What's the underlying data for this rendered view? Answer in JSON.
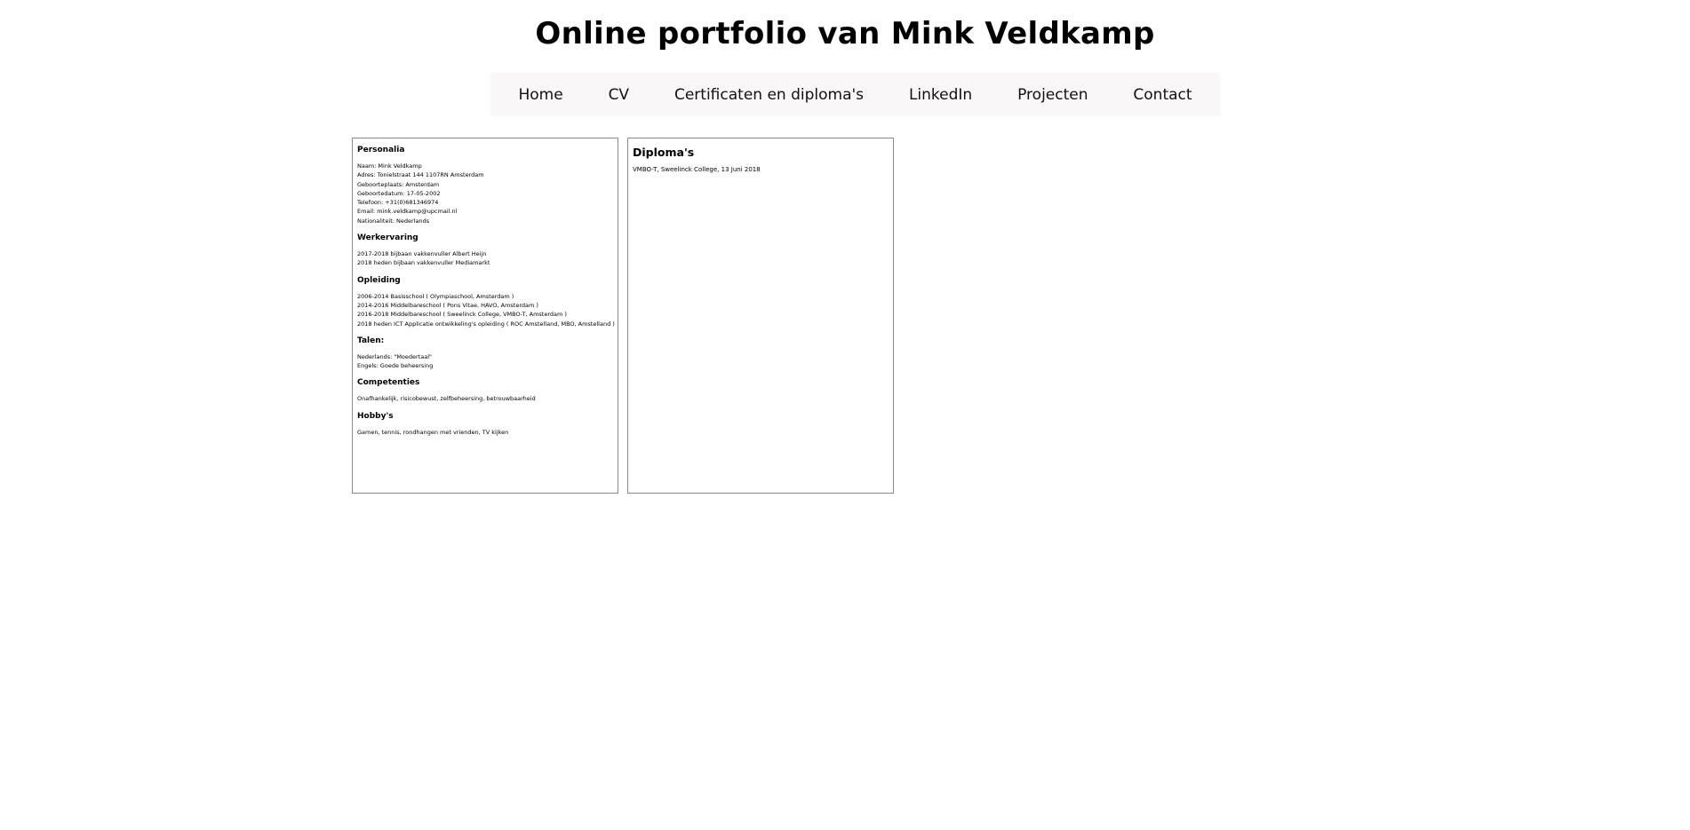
{
  "header": {
    "title": "Online portfolio van Mink Veldkamp"
  },
  "nav": {
    "items": [
      {
        "label": "Home"
      },
      {
        "label": "CV"
      },
      {
        "label": "Certificaten en diploma's"
      },
      {
        "label": "LinkedIn"
      },
      {
        "label": "Projecten"
      },
      {
        "label": "Contact"
      }
    ]
  },
  "cv": {
    "sections": [
      {
        "heading": "Personalia",
        "lines": [
          "Naam: Mink Veldkamp",
          "Adres: Tonielstraat 144 1107RN Amsterdam",
          "Geboorteplaats: Amsterdam",
          "Geboortedatum: 17-05-2002",
          "Telefoon: +31(0)681346974",
          "Email: mink.veldkamp@upcmail.nl",
          "Nationaliteit: Nederlands"
        ]
      },
      {
        "heading": "Werkervaring",
        "lines": [
          "2017-2018 bijbaan vakkenvuller Albert Heijn",
          "2018 heden bijbaan vakkenvuller Mediamarkt"
        ]
      },
      {
        "heading": "Opleiding",
        "lines": [
          "2006-2014 Basisschool ( Olympiaschool, Amsterdam )",
          "2014-2016 Middelbareschool ( Pons Vitae, HAVO, Amsterdam )",
          "2016-2018 Middelbareschool ( Sweelinck College, VMBO-T, Amsterdam )",
          "2018 heden ICT Applicatie ontwikkeling's opleiding ( ROC Amstelland, MBO, Amstelland )"
        ]
      },
      {
        "heading": "Talen:",
        "lines": [
          "Nederlands: \"Moedertaal\"",
          "Engels: Goede beheersing"
        ]
      },
      {
        "heading": "Competenties",
        "lines": [
          "Onafhankelijk, risicobewust, zelfbeheersing, betrouwbaarheid"
        ]
      },
      {
        "heading": "Hobby's",
        "lines": [
          "Gamen, tennis, rondhangen met vrienden, TV kijken"
        ]
      }
    ]
  },
  "diplomas": {
    "heading": "Diploma's",
    "lines": [
      "VMBO-T, Sweelinck College, 13 Juni 2018"
    ]
  }
}
